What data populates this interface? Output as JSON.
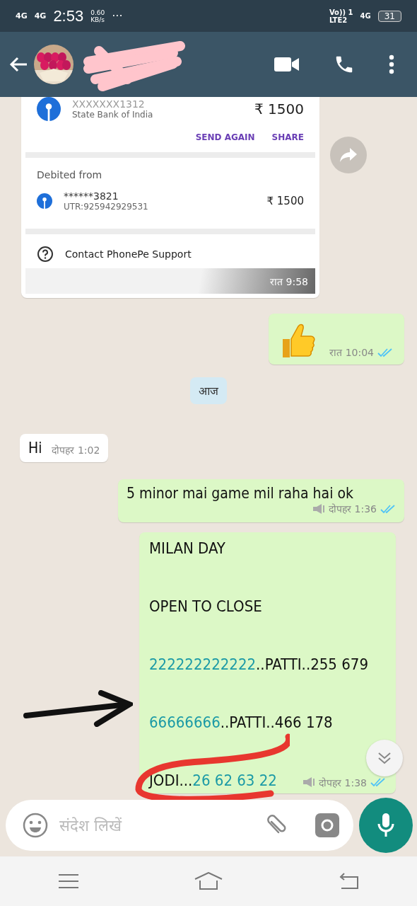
{
  "status_bar": {
    "sim1": "4G",
    "sim2": "4G",
    "time": "2:53",
    "speed": "0.60",
    "speed_unit": "KB/s",
    "more": "···",
    "volte": "Vo)) 1",
    "lte": "LTE2",
    "network": "4G",
    "battery": "31"
  },
  "messages": [
    {
      "kind": "payment_card",
      "outgoing": false,
      "account": "XXXXXXX1312",
      "bank": "State Bank of India",
      "amount": "₹ 1500",
      "actions": [
        "SEND AGAIN",
        "SHARE"
      ],
      "debited_label": "Debited from",
      "debit_account": "******3821",
      "utr": "UTR:925942929531",
      "debit_amount": "₹ 1500",
      "support": "Contact PhonePe Support",
      "time": "रात 9:58"
    },
    {
      "kind": "emoji",
      "outgoing": true,
      "time": "रात 10:04",
      "read": true
    },
    {
      "kind": "date",
      "text": "आज"
    },
    {
      "kind": "text",
      "outgoing": false,
      "text": "Hi",
      "time": "दोपहर 1:02"
    },
    {
      "kind": "text",
      "outgoing": true,
      "text": "5 minor mai game mil raha hai ok",
      "time": "दोपहर 1:36",
      "read": true,
      "broadcast": true
    },
    {
      "kind": "lines",
      "outgoing": true,
      "time": "दोपहर 1:38",
      "read": true,
      "broadcast": true,
      "lines": [
        [
          {
            "text": "MILAN DAY",
            "kind": "plain"
          }
        ],
        [
          {
            "text": "OPEN TO CLOSE",
            "kind": "plain"
          }
        ],
        [
          {
            "text": "222222222222",
            "kind": "number"
          },
          {
            "text": "..PATTI..255  679",
            "kind": "plain"
          }
        ],
        [
          {
            "text": "66666666",
            "kind": "number"
          },
          {
            "text": "..PATTI..466 178",
            "kind": "plain"
          }
        ],
        [
          {
            "text": "JODI...",
            "kind": "plain"
          },
          {
            "text": "26 62 63 22",
            "kind": "number"
          }
        ]
      ]
    }
  ],
  "composer": {
    "placeholder": "संदेश लिखें"
  }
}
